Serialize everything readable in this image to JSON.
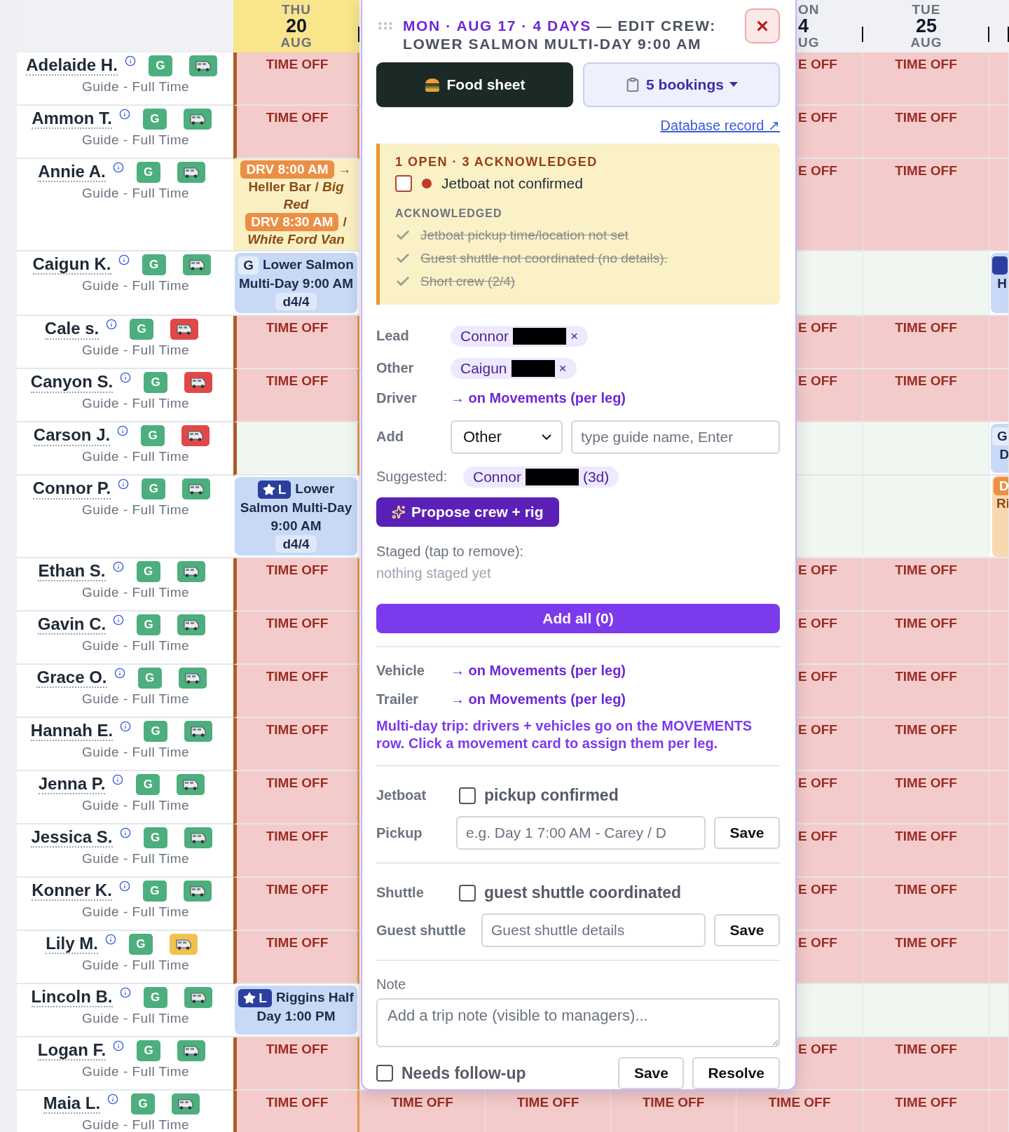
{
  "grid": {
    "days": [
      {
        "kind": "day",
        "weekday": "THU",
        "day": "20",
        "month": "AUG",
        "today": true
      },
      {
        "kind": "covered"
      },
      {
        "kind": "covered"
      },
      {
        "kind": "covered"
      },
      {
        "kind": "day",
        "weekday": "ON",
        "day": "4",
        "month": "UG"
      },
      {
        "kind": "day",
        "weekday": "TUE",
        "day": "25",
        "month": "AUG"
      },
      {
        "kind": "day"
      }
    ],
    "rows": [
      {
        "name": "Adelaide H.",
        "role_badge": "G",
        "role": "Guide - Full Time",
        "vehicle": {
          "color": "#4caf7d"
        },
        "cells": [
          {
            "kind": "time_off",
            "text": "TIME OFF"
          },
          {
            "kind": "covered"
          },
          {
            "kind": "covered"
          },
          {
            "kind": "covered"
          },
          {
            "kind": "time_off",
            "text": "E OFF"
          },
          {
            "kind": "time_off",
            "text": "TIME OFF"
          },
          {
            "kind": "time_off"
          }
        ]
      },
      {
        "name": "Ammon T.",
        "role_badge": "G",
        "role": "Guide - Full Time",
        "vehicle": {
          "color": "#4caf7d"
        },
        "cells": [
          {
            "kind": "time_off",
            "text": "TIME OFF"
          },
          {
            "kind": "covered"
          },
          {
            "kind": "covered"
          },
          {
            "kind": "covered"
          },
          {
            "kind": "time_off",
            "text": "E OFF"
          },
          {
            "kind": "time_off",
            "text": "TIME OFF"
          },
          {
            "kind": "time_off"
          }
        ]
      },
      {
        "name": "Annie A.",
        "role_badge": "G",
        "role": "Guide - Full Time",
        "vehicle": {
          "color": "#4caf7d"
        },
        "cells": [
          {
            "kind": "drive",
            "moves": [
              {
                "time": "DRV 8:00 AM",
                "after": "→",
                "text": "Heller Bar / *Big Red*"
              },
              {
                "time": "DRV 8:30 AM",
                "after": "/",
                "text": "*White Ford Van*"
              }
            ]
          },
          {
            "kind": "covered"
          },
          {
            "kind": "covered"
          },
          {
            "kind": "covered"
          },
          {
            "kind": "time_off",
            "text": "E OFF"
          },
          {
            "kind": "time_off",
            "text": "TIME OFF"
          },
          {
            "kind": "time_off"
          }
        ]
      },
      {
        "name": "Caigun K.",
        "role_badge": "G",
        "role": "Guide - Full Time",
        "vehicle": {
          "color": "#4caf7d"
        },
        "cells": [
          {
            "kind": "trip",
            "lead": false,
            "badge": "G",
            "title": "Lower Salmon Multi-Day 9:00 AM",
            "day_chip": "d4/4"
          },
          {
            "kind": "covered"
          },
          {
            "kind": "covered"
          },
          {
            "kind": "covered"
          },
          {
            "kind": "free"
          },
          {
            "kind": "free"
          },
          {
            "kind": "trip",
            "lead": true,
            "title": "H"
          }
        ]
      },
      {
        "name": "Cale s.",
        "role_badge": "G",
        "role": "Guide - Full Time",
        "vehicle": {
          "color": "#e04848"
        },
        "cells": [
          {
            "kind": "time_off",
            "text": "TIME OFF"
          },
          {
            "kind": "covered"
          },
          {
            "kind": "covered"
          },
          {
            "kind": "covered"
          },
          {
            "kind": "time_off",
            "text": "E OFF"
          },
          {
            "kind": "time_off",
            "text": "TIME OFF"
          },
          {
            "kind": "time_off"
          }
        ]
      },
      {
        "name": "Canyon S.",
        "role_badge": "G",
        "role": "Guide - Full Time",
        "vehicle": {
          "color": "#e04848"
        },
        "cells": [
          {
            "kind": "time_off",
            "text": "TIME OFF"
          },
          {
            "kind": "covered"
          },
          {
            "kind": "covered"
          },
          {
            "kind": "covered"
          },
          {
            "kind": "time_off",
            "text": "E OFF"
          },
          {
            "kind": "time_off",
            "text": "TIME OFF"
          },
          {
            "kind": "time_off"
          }
        ]
      },
      {
        "name": "Carson J.",
        "role_badge": "G",
        "role": "Guide - Full Time",
        "vehicle": {
          "color": "#e04848"
        },
        "cells": [
          {
            "kind": "free"
          },
          {
            "kind": "covered"
          },
          {
            "kind": "covered"
          },
          {
            "kind": "covered"
          },
          {
            "kind": "free"
          },
          {
            "kind": "free"
          },
          {
            "kind": "trip",
            "lead": false,
            "badge": "G",
            "title": "D"
          }
        ]
      },
      {
        "name": "Connor P.",
        "role_badge": "G",
        "role": "Guide - Full Time",
        "vehicle": {
          "color": "#4caf7d"
        },
        "cells": [
          {
            "kind": "trip",
            "lead": true,
            "badge": "L",
            "title": "Lower Salmon Multi-Day 9:00 AM",
            "day_chip": "d4/4"
          },
          {
            "kind": "covered"
          },
          {
            "kind": "covered"
          },
          {
            "kind": "covered"
          },
          {
            "kind": "free"
          },
          {
            "kind": "free"
          },
          {
            "kind": "drive",
            "moves": [
              {
                "time": "D",
                "text": "Ri"
              }
            ]
          }
        ]
      },
      {
        "name": "Ethan S.",
        "role_badge": "G",
        "role": "Guide - Full Time",
        "vehicle": {
          "color": "#4caf7d"
        },
        "cells": [
          {
            "kind": "time_off",
            "text": "TIME OFF"
          },
          {
            "kind": "covered"
          },
          {
            "kind": "covered"
          },
          {
            "kind": "covered"
          },
          {
            "kind": "time_off",
            "text": "E OFF"
          },
          {
            "kind": "time_off",
            "text": "TIME OFF"
          },
          {
            "kind": "time_off"
          }
        ]
      },
      {
        "name": "Gavin C.",
        "role_badge": "G",
        "role": "Guide - Full Time",
        "vehicle": {
          "color": "#4caf7d"
        },
        "cells": [
          {
            "kind": "time_off",
            "text": "TIME OFF"
          },
          {
            "kind": "covered"
          },
          {
            "kind": "covered"
          },
          {
            "kind": "covered"
          },
          {
            "kind": "time_off",
            "text": "E OFF"
          },
          {
            "kind": "time_off",
            "text": "TIME OFF"
          },
          {
            "kind": "time_off"
          }
        ]
      },
      {
        "name": "Grace O.",
        "role_badge": "G",
        "role": "Guide - Full Time",
        "vehicle": {
          "color": "#4caf7d"
        },
        "cells": [
          {
            "kind": "time_off",
            "text": "TIME OFF"
          },
          {
            "kind": "covered"
          },
          {
            "kind": "covered"
          },
          {
            "kind": "covered"
          },
          {
            "kind": "time_off",
            "text": "E OFF"
          },
          {
            "kind": "time_off",
            "text": "TIME OFF"
          },
          {
            "kind": "time_off"
          }
        ]
      },
      {
        "name": "Hannah E.",
        "role_badge": "G",
        "role": "Guide - Full Time",
        "vehicle": {
          "color": "#4caf7d"
        },
        "cells": [
          {
            "kind": "time_off",
            "text": "TIME OFF"
          },
          {
            "kind": "covered"
          },
          {
            "kind": "covered"
          },
          {
            "kind": "covered"
          },
          {
            "kind": "time_off",
            "text": "E OFF"
          },
          {
            "kind": "time_off",
            "text": "TIME OFF"
          },
          {
            "kind": "time_off"
          }
        ]
      },
      {
        "name": "Jenna P.",
        "role_badge": "G",
        "role": "Guide - Full Time",
        "vehicle": {
          "color": "#4caf7d"
        },
        "cells": [
          {
            "kind": "time_off",
            "text": "TIME OFF"
          },
          {
            "kind": "covered"
          },
          {
            "kind": "covered"
          },
          {
            "kind": "covered"
          },
          {
            "kind": "time_off",
            "text": "E OFF"
          },
          {
            "kind": "time_off",
            "text": "TIME OFF"
          },
          {
            "kind": "time_off"
          }
        ]
      },
      {
        "name": "Jessica S.",
        "role_badge": "G",
        "role": "Guide - Full Time",
        "vehicle": {
          "color": "#4caf7d"
        },
        "cells": [
          {
            "kind": "time_off",
            "text": "TIME OFF"
          },
          {
            "kind": "covered"
          },
          {
            "kind": "covered"
          },
          {
            "kind": "covered"
          },
          {
            "kind": "time_off",
            "text": "E OFF"
          },
          {
            "kind": "time_off",
            "text": "TIME OFF"
          },
          {
            "kind": "time_off"
          }
        ]
      },
      {
        "name": "Konner K.",
        "role_badge": "G",
        "role": "Guide - Full Time",
        "vehicle": {
          "color": "#4caf7d"
        },
        "cells": [
          {
            "kind": "time_off",
            "text": "TIME OFF"
          },
          {
            "kind": "covered"
          },
          {
            "kind": "covered"
          },
          {
            "kind": "covered"
          },
          {
            "kind": "time_off",
            "text": "E OFF"
          },
          {
            "kind": "time_off",
            "text": "TIME OFF"
          },
          {
            "kind": "time_off"
          }
        ]
      },
      {
        "name": "Lily M.",
        "role_badge": "G",
        "role": "Guide - Full Time",
        "vehicle": {
          "color": "#f2c14e"
        },
        "cells": [
          {
            "kind": "time_off",
            "text": "TIME OFF"
          },
          {
            "kind": "covered"
          },
          {
            "kind": "covered"
          },
          {
            "kind": "covered"
          },
          {
            "kind": "time_off",
            "text": "E OFF"
          },
          {
            "kind": "time_off",
            "text": "TIME OFF"
          },
          {
            "kind": "time_off"
          }
        ]
      },
      {
        "name": "Lincoln B.",
        "role_badge": "G",
        "role": "Guide - Full Time",
        "vehicle": {
          "color": "#4caf7d"
        },
        "cells": [
          {
            "kind": "trip",
            "lead": true,
            "badge": "L",
            "title": "Riggins Half Day 1:00 PM"
          },
          {
            "kind": "covered"
          },
          {
            "kind": "covered"
          },
          {
            "kind": "covered"
          },
          {
            "kind": "free"
          },
          {
            "kind": "free"
          },
          {
            "kind": "free"
          }
        ]
      },
      {
        "name": "Logan F.",
        "role_badge": "G",
        "role": "Guide - Full Time",
        "vehicle": {
          "color": "#4caf7d"
        },
        "cells": [
          {
            "kind": "time_off",
            "text": "TIME OFF"
          },
          {
            "kind": "covered"
          },
          {
            "kind": "covered"
          },
          {
            "kind": "covered"
          },
          {
            "kind": "time_off",
            "text": "E OFF"
          },
          {
            "kind": "time_off",
            "text": "TIME OFF"
          },
          {
            "kind": "time_off"
          }
        ]
      },
      {
        "name": "Maia L.",
        "role_badge": "G",
        "role": "Guide - Full Time",
        "vehicle": {
          "color": "#4caf7d"
        },
        "cells": [
          {
            "kind": "time_off",
            "text": "TIME OFF"
          },
          {
            "kind": "time_off",
            "text": "TIME OFF"
          },
          {
            "kind": "time_off",
            "text": "TIME OFF"
          },
          {
            "kind": "time_off",
            "text": "TIME OFF"
          },
          {
            "kind": "time_off",
            "text": "TIME OFF"
          },
          {
            "kind": "time_off",
            "text": "TIME OFF"
          },
          {
            "kind": "time_off"
          }
        ]
      }
    ]
  },
  "dialog": {
    "date": "MON · AUG 17 · 4 DAYS",
    "title": "— EDIT CREW: LOWER SALMON MULTI-DAY 9:00 AM",
    "close": "×",
    "food_button": "Food sheet",
    "bookings_button": "5 bookings",
    "record_link": "Database record ↗",
    "issues": {
      "summary": "1 OPEN · 3 ACKNOWLEDGED",
      "open": [
        {
          "text": "Jetboat not confirmed",
          "checked": false
        }
      ],
      "acknowledged_label": "ACKNOWLEDGED",
      "acknowledged": [
        "Jetboat pickup time/location not set",
        "Guest shuttle not coordinated (no details).",
        "Short crew (2/4)"
      ]
    },
    "crew": [
      {
        "label": "Lead",
        "name": "Connor",
        "remove": "×"
      },
      {
        "label": "Other",
        "name": "Caigun",
        "remove": "×"
      }
    ],
    "driver": {
      "label": "Driver",
      "link": "→ on Movements (per leg)"
    },
    "add": {
      "label": "Add",
      "role": "Other",
      "placeholder": "type guide name, Enter"
    },
    "suggested": {
      "label": "Suggested:",
      "name": "Connor",
      "days": "(3d)"
    },
    "propose_button": "Propose crew + rig",
    "staged_label": "Staged (tap to remove):",
    "staged_empty": "nothing staged yet",
    "add_all_button": "Add all (0)",
    "assignments": [
      {
        "label": "Vehicle",
        "link": "→ on Movements (per leg)"
      },
      {
        "label": "Trailer",
        "link": "→ on Movements (per leg)"
      }
    ],
    "multi_day_note": "Multi-day trip: drivers + vehicles go on the MOVEMENTS row. Click a movement card to assign them per leg.",
    "jetboat": {
      "label": "Jetboat",
      "checkbox": "pickup confirmed",
      "checked": false,
      "field_label": "Pickup",
      "placeholder": "e.g. Day 1 7:00 AM - Carey / D",
      "save": "Save"
    },
    "shuttle": {
      "label": "Shuttle",
      "checkbox": "guest shuttle coordinated",
      "checked": false,
      "field_label": "Guest shuttle",
      "placeholder": "Guest shuttle details",
      "save": "Save"
    },
    "note": {
      "label": "Note",
      "placeholder": "Add a trip note (visible to managers)..."
    },
    "follow_up": {
      "label": "Needs follow-up",
      "checked": false
    },
    "footer_buttons": [
      "Save",
      "Resolve"
    ]
  }
}
